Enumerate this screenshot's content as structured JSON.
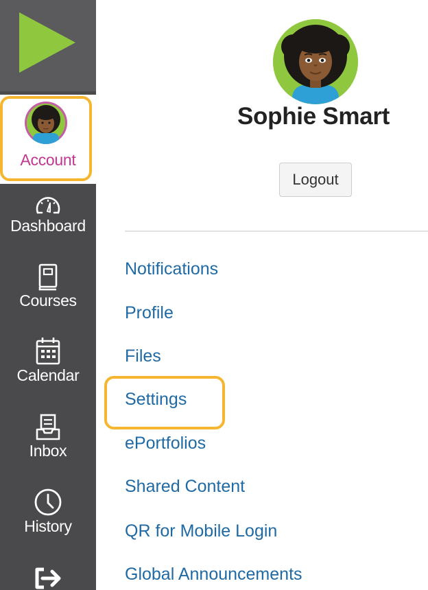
{
  "colors": {
    "nav_bg": "#4a4a4c",
    "logo_bg": "#5b5b5e",
    "logo_play": "#8fc73e",
    "account_label": "#c2368f",
    "highlight": "#f6b52e",
    "link": "#1f6aa5",
    "avatar_ring": "#8fc73e"
  },
  "nav": {
    "logo_icon": "play-triangle-icon",
    "items": [
      {
        "label": "Account",
        "icon": "user-avatar",
        "selected": true
      },
      {
        "label": "Dashboard",
        "icon": "speedometer-icon"
      },
      {
        "label": "Courses",
        "icon": "book-icon"
      },
      {
        "label": "Calendar",
        "icon": "calendar-icon"
      },
      {
        "label": "Inbox",
        "icon": "inbox-icon"
      },
      {
        "label": "History",
        "icon": "clock-icon"
      },
      {
        "label": "",
        "icon": "logout-arrow-icon"
      }
    ]
  },
  "profile": {
    "name": "Sophie Smart",
    "logout_label": "Logout"
  },
  "menu": [
    {
      "label": "Notifications"
    },
    {
      "label": "Profile"
    },
    {
      "label": "Files"
    },
    {
      "label": "Settings",
      "highlighted": true
    },
    {
      "label": "ePortfolios"
    },
    {
      "label": "Shared Content"
    },
    {
      "label": "QR for Mobile Login"
    },
    {
      "label": "Global Announcements"
    }
  ]
}
